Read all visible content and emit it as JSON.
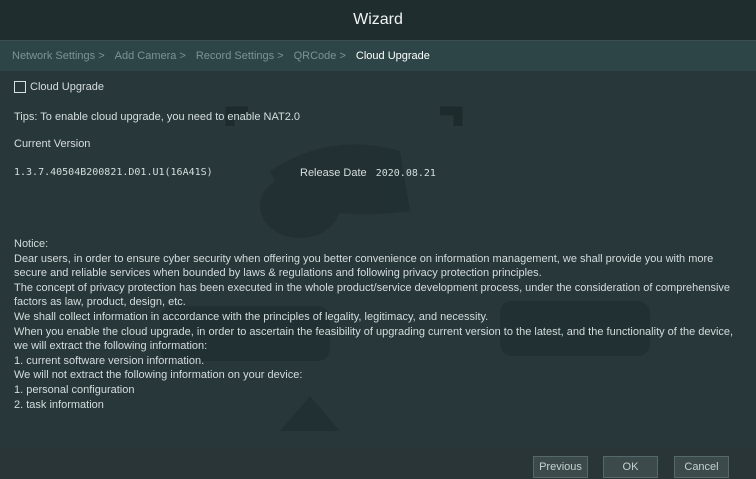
{
  "window": {
    "title": "Wizard"
  },
  "tabs": [
    {
      "label": "Network Settings >",
      "active": false
    },
    {
      "label": "Add Camera >",
      "active": false
    },
    {
      "label": "Record Settings >",
      "active": false
    },
    {
      "label": "QRCode >",
      "active": false
    },
    {
      "label": "Cloud Upgrade",
      "active": true
    }
  ],
  "cloud_upgrade": {
    "checkbox_label": "Cloud Upgrade",
    "checked": false,
    "tips": "Tips: To enable cloud upgrade, you need to enable NAT2.0",
    "current_version_label": "Current Version",
    "version_value": "1.3.7.40504B200821.D01.U1(16A41S)",
    "release_date_label": "Release Date",
    "release_date_value": "2020.08.21"
  },
  "notice": {
    "heading": "Notice:",
    "lines": [
      "Dear users, in order to ensure cyber security when offering you better convenience on information management, we shall provide you with more",
      "secure and reliable services when bounded by laws & regulations and following privacy protection principles.",
      "The concept of privacy protection has been executed in the whole product/service development process, under the consideration of comprehensive",
      "factors as law, product, design, etc.",
      "We shall collect information in accordance with the principles of legality, legitimacy, and necessity.",
      "When you enable the cloud upgrade, in order to ascertain the feasibility of upgrading current version to the latest, and the functionality of the device,",
      "we will extract the following information:",
      "1. current software version information.",
      "We will not extract the following information on your device:",
      "1. personal configuration",
      "2. task information"
    ]
  },
  "footer": {
    "previous_label": "Previous",
    "ok_label": "OK",
    "cancel_label": "Cancel"
  },
  "colors": {
    "background": "#27373a",
    "tab_bar": "#2e4548",
    "active_tab": "#ffffff",
    "inactive_tab": "#7d9296"
  }
}
